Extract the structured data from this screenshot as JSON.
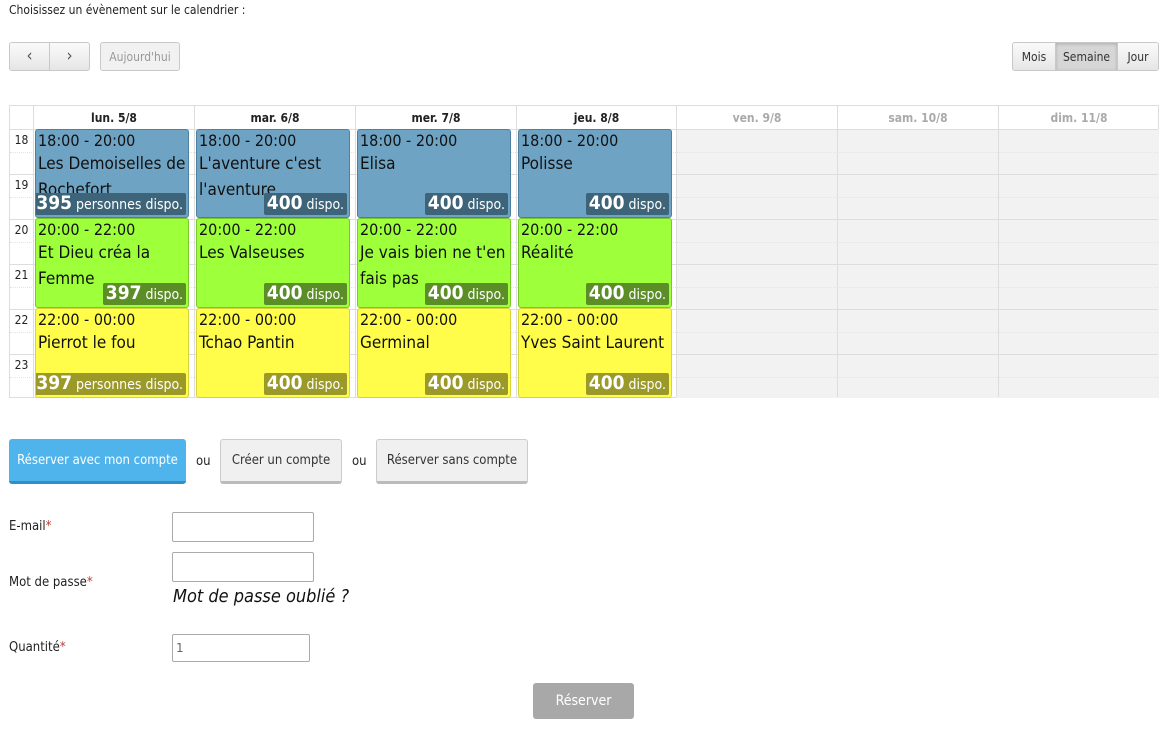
{
  "intro": "Choisissez un évènement sur le calendrier :",
  "toolbar": {
    "today": "Aujourd'hui",
    "views": [
      "Mois",
      "Semaine",
      "Jour"
    ]
  },
  "calendar": {
    "days": [
      "lun. 5/8",
      "mar. 6/8",
      "mer. 7/8",
      "jeu. 8/8",
      "ven. 9/8",
      "sam. 10/8",
      "dim. 11/8"
    ],
    "hours": [
      "18",
      "19",
      "20",
      "21",
      "22",
      "23"
    ],
    "events": [
      {
        "time": "18:00 - 20:00",
        "title": "Les Demoiselles de Rochefort",
        "count": "395",
        "suffix": "personnes dispo."
      },
      {
        "time": "18:00 - 20:00",
        "title": "L'aventure c'est l'aventure",
        "count": "400",
        "suffix": "dispo."
      },
      {
        "time": "18:00 - 20:00",
        "title": "Elisa",
        "count": "400",
        "suffix": "dispo."
      },
      {
        "time": "18:00 - 20:00",
        "title": "Polisse",
        "count": "400",
        "suffix": "dispo."
      },
      {
        "time": "20:00 - 22:00",
        "title": "Et Dieu créa la Femme",
        "count": "397",
        "suffix": "dispo."
      },
      {
        "time": "20:00 - 22:00",
        "title": "Les Valseuses",
        "count": "400",
        "suffix": "dispo."
      },
      {
        "time": "20:00 - 22:00",
        "title": "Je vais bien ne t'en fais pas",
        "count": "400",
        "suffix": "dispo."
      },
      {
        "time": "20:00 - 22:00",
        "title": "Réalité",
        "count": "400",
        "suffix": "dispo."
      },
      {
        "time": "22:00 - 00:00",
        "title": "Pierrot le fou",
        "count": "397",
        "suffix": "personnes dispo."
      },
      {
        "time": "22:00 - 00:00",
        "title": "Tchao Pantin",
        "count": "400",
        "suffix": "dispo."
      },
      {
        "time": "22:00 - 00:00",
        "title": "Germinal",
        "count": "400",
        "suffix": "dispo."
      },
      {
        "time": "22:00 - 00:00",
        "title": "Yves Saint Laurent",
        "count": "400",
        "suffix": "dispo."
      }
    ]
  },
  "auth": {
    "with_account": "Réserver avec mon compte",
    "or1": "ou",
    "create_account": "Créer un compte",
    "or2": "ou",
    "without_account": "Réserver sans compte"
  },
  "form": {
    "email_label": "E-mail",
    "password_label": "Mot de passe",
    "forgot": "Mot de passe oublié ?",
    "quantity_label": "Quantité",
    "quantity_value": "1",
    "required_mark": "*",
    "submit": "Réserver"
  }
}
